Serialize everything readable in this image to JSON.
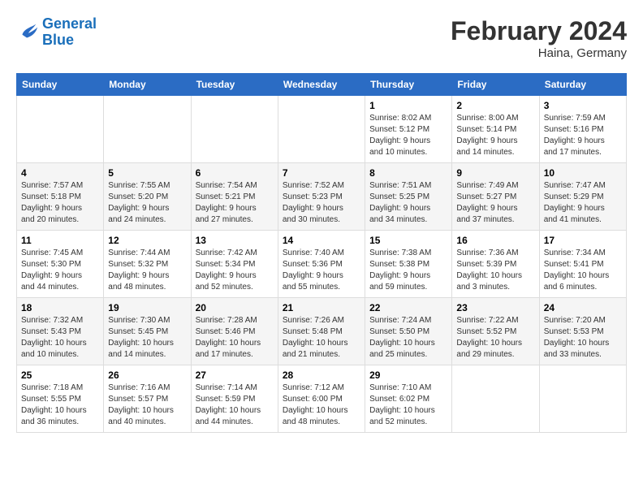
{
  "header": {
    "logo_line1": "General",
    "logo_line2": "Blue",
    "main_title": "February 2024",
    "sub_title": "Haina, Germany"
  },
  "calendar": {
    "days_of_week": [
      "Sunday",
      "Monday",
      "Tuesday",
      "Wednesday",
      "Thursday",
      "Friday",
      "Saturday"
    ],
    "weeks": [
      [
        {
          "day": "",
          "info": ""
        },
        {
          "day": "",
          "info": ""
        },
        {
          "day": "",
          "info": ""
        },
        {
          "day": "",
          "info": ""
        },
        {
          "day": "1",
          "info": "Sunrise: 8:02 AM\nSunset: 5:12 PM\nDaylight: 9 hours\nand 10 minutes."
        },
        {
          "day": "2",
          "info": "Sunrise: 8:00 AM\nSunset: 5:14 PM\nDaylight: 9 hours\nand 14 minutes."
        },
        {
          "day": "3",
          "info": "Sunrise: 7:59 AM\nSunset: 5:16 PM\nDaylight: 9 hours\nand 17 minutes."
        }
      ],
      [
        {
          "day": "4",
          "info": "Sunrise: 7:57 AM\nSunset: 5:18 PM\nDaylight: 9 hours\nand 20 minutes."
        },
        {
          "day": "5",
          "info": "Sunrise: 7:55 AM\nSunset: 5:20 PM\nDaylight: 9 hours\nand 24 minutes."
        },
        {
          "day": "6",
          "info": "Sunrise: 7:54 AM\nSunset: 5:21 PM\nDaylight: 9 hours\nand 27 minutes."
        },
        {
          "day": "7",
          "info": "Sunrise: 7:52 AM\nSunset: 5:23 PM\nDaylight: 9 hours\nand 30 minutes."
        },
        {
          "day": "8",
          "info": "Sunrise: 7:51 AM\nSunset: 5:25 PM\nDaylight: 9 hours\nand 34 minutes."
        },
        {
          "day": "9",
          "info": "Sunrise: 7:49 AM\nSunset: 5:27 PM\nDaylight: 9 hours\nand 37 minutes."
        },
        {
          "day": "10",
          "info": "Sunrise: 7:47 AM\nSunset: 5:29 PM\nDaylight: 9 hours\nand 41 minutes."
        }
      ],
      [
        {
          "day": "11",
          "info": "Sunrise: 7:45 AM\nSunset: 5:30 PM\nDaylight: 9 hours\nand 44 minutes."
        },
        {
          "day": "12",
          "info": "Sunrise: 7:44 AM\nSunset: 5:32 PM\nDaylight: 9 hours\nand 48 minutes."
        },
        {
          "day": "13",
          "info": "Sunrise: 7:42 AM\nSunset: 5:34 PM\nDaylight: 9 hours\nand 52 minutes."
        },
        {
          "day": "14",
          "info": "Sunrise: 7:40 AM\nSunset: 5:36 PM\nDaylight: 9 hours\nand 55 minutes."
        },
        {
          "day": "15",
          "info": "Sunrise: 7:38 AM\nSunset: 5:38 PM\nDaylight: 9 hours\nand 59 minutes."
        },
        {
          "day": "16",
          "info": "Sunrise: 7:36 AM\nSunset: 5:39 PM\nDaylight: 10 hours\nand 3 minutes."
        },
        {
          "day": "17",
          "info": "Sunrise: 7:34 AM\nSunset: 5:41 PM\nDaylight: 10 hours\nand 6 minutes."
        }
      ],
      [
        {
          "day": "18",
          "info": "Sunrise: 7:32 AM\nSunset: 5:43 PM\nDaylight: 10 hours\nand 10 minutes."
        },
        {
          "day": "19",
          "info": "Sunrise: 7:30 AM\nSunset: 5:45 PM\nDaylight: 10 hours\nand 14 minutes."
        },
        {
          "day": "20",
          "info": "Sunrise: 7:28 AM\nSunset: 5:46 PM\nDaylight: 10 hours\nand 17 minutes."
        },
        {
          "day": "21",
          "info": "Sunrise: 7:26 AM\nSunset: 5:48 PM\nDaylight: 10 hours\nand 21 minutes."
        },
        {
          "day": "22",
          "info": "Sunrise: 7:24 AM\nSunset: 5:50 PM\nDaylight: 10 hours\nand 25 minutes."
        },
        {
          "day": "23",
          "info": "Sunrise: 7:22 AM\nSunset: 5:52 PM\nDaylight: 10 hours\nand 29 minutes."
        },
        {
          "day": "24",
          "info": "Sunrise: 7:20 AM\nSunset: 5:53 PM\nDaylight: 10 hours\nand 33 minutes."
        }
      ],
      [
        {
          "day": "25",
          "info": "Sunrise: 7:18 AM\nSunset: 5:55 PM\nDaylight: 10 hours\nand 36 minutes."
        },
        {
          "day": "26",
          "info": "Sunrise: 7:16 AM\nSunset: 5:57 PM\nDaylight: 10 hours\nand 40 minutes."
        },
        {
          "day": "27",
          "info": "Sunrise: 7:14 AM\nSunset: 5:59 PM\nDaylight: 10 hours\nand 44 minutes."
        },
        {
          "day": "28",
          "info": "Sunrise: 7:12 AM\nSunset: 6:00 PM\nDaylight: 10 hours\nand 48 minutes."
        },
        {
          "day": "29",
          "info": "Sunrise: 7:10 AM\nSunset: 6:02 PM\nDaylight: 10 hours\nand 52 minutes."
        },
        {
          "day": "",
          "info": ""
        },
        {
          "day": "",
          "info": ""
        }
      ]
    ]
  }
}
